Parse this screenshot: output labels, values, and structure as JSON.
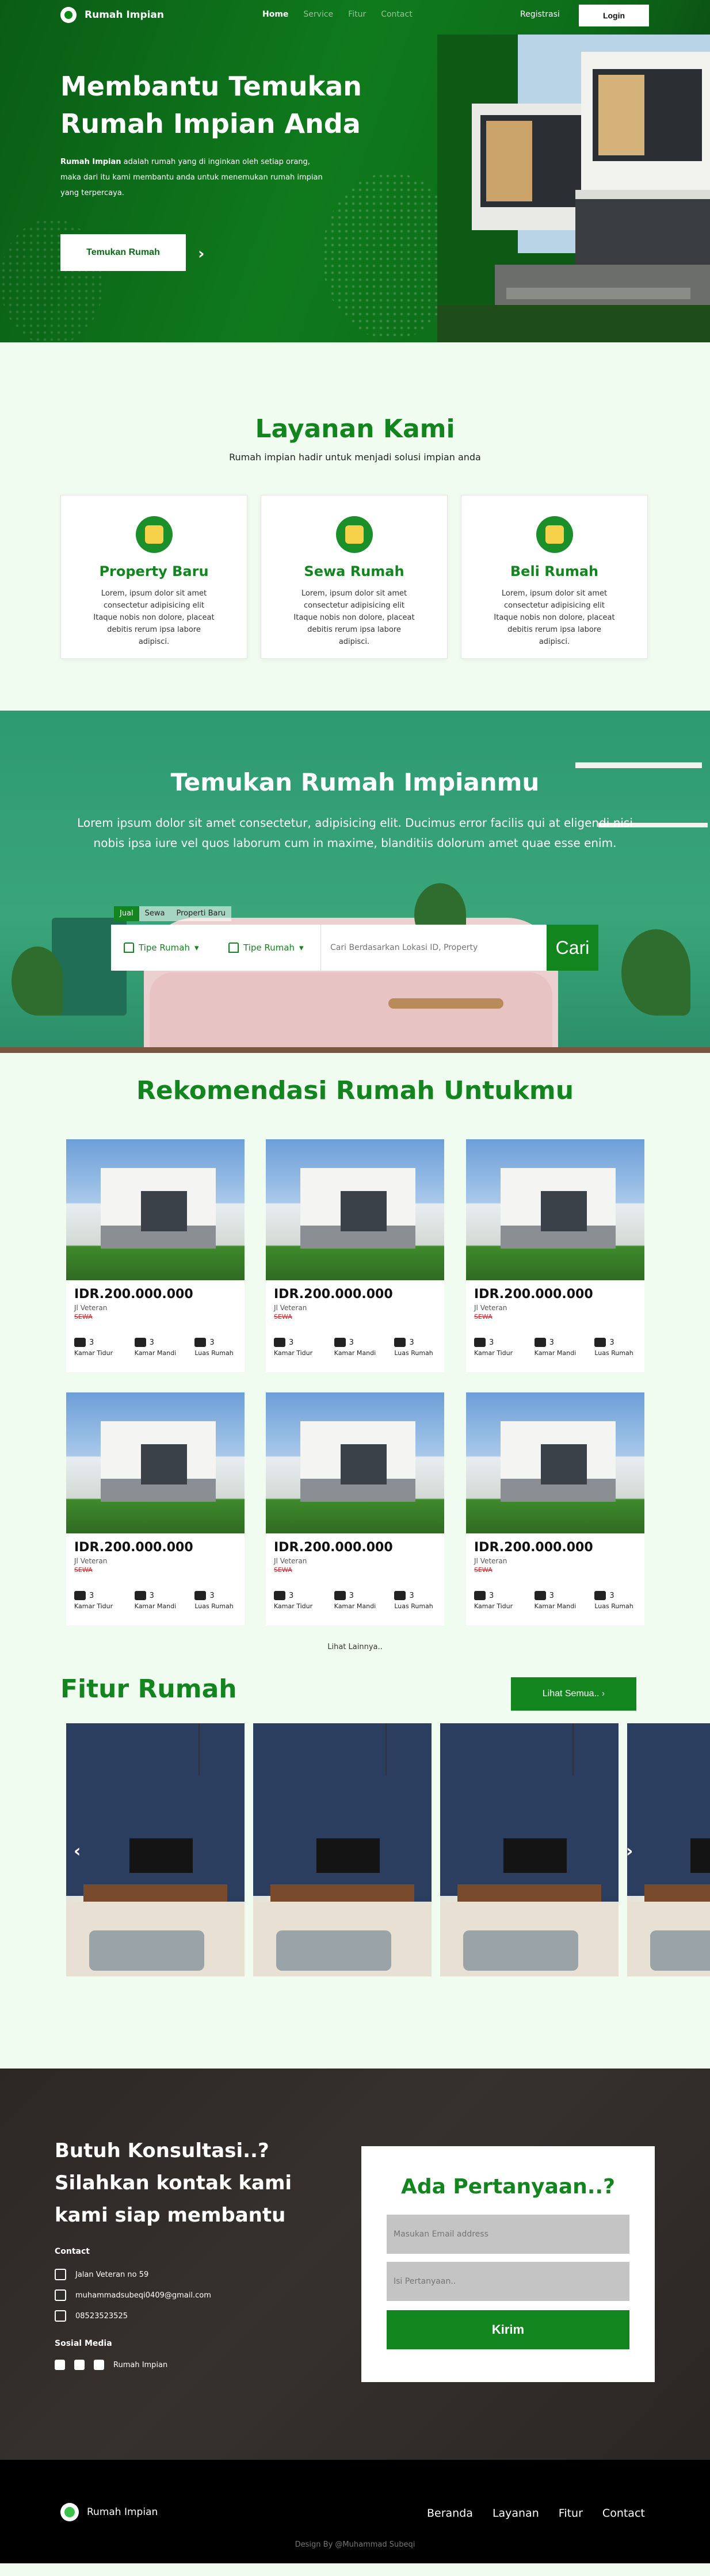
{
  "nav": {
    "brand": "Rumah Impian",
    "links": [
      "Home",
      "Service",
      "Fitur",
      "Contact"
    ],
    "register": "Registrasi",
    "login": "Login"
  },
  "hero": {
    "title": "Membantu Temukan Rumah Impian Anda",
    "desc_bold": "Rumah Impian",
    "desc": " adalah rumah yang di inginkan oleh setiap orang, maka dari itu kami membantu anda untuk menemukan rumah impian yang terpercaya.",
    "cta": "Temukan Rumah",
    "arrow": "›"
  },
  "layanan": {
    "title": "Layanan Kami",
    "subtitle": "Rumah impian hadir untuk menjadi solusi impian anda",
    "cards": [
      {
        "title": "Property Baru",
        "text": "Lorem, ipsum dolor sit amet consectetur adipisicing elit Itaque nobis non dolore, placeat debitis rerum ipsa labore adipisci."
      },
      {
        "title": "Sewa Rumah",
        "text": "Lorem, ipsum dolor sit amet consectetur adipisicing elit Itaque nobis non dolore, placeat debitis rerum ipsa labore adipisci."
      },
      {
        "title": "Beli Rumah",
        "text": "Lorem, ipsum dolor sit amet consectetur adipisicing elit Itaque nobis non dolore, placeat debitis rerum ipsa labore adipisci."
      }
    ]
  },
  "search": {
    "title": "Temukan Rumah Impianmu",
    "desc": "Lorem ipsum dolor sit amet consectetur, adipisicing elit. Ducimus error facilis qui at eligendi nisi nobis ipsa iure vel quos laborum cum in maxime, blanditiis dolorum amet quae esse enim.",
    "tabs": [
      "Jual",
      "Sewa",
      "Properti Baru"
    ],
    "select1": "Tipe Rumah",
    "select2": "Tipe Rumah",
    "placeholder": "Cari Berdasarkan Lokasi ID, Property",
    "button": "Cari"
  },
  "rekomendasi": {
    "title": "Rekomendasi Rumah Untukmu",
    "cards": [
      {
        "price": "IDR.200.000.000",
        "address": "Jl Veteran",
        "tag": "SEWA",
        "beds": "3",
        "baths": "3",
        "area": "3"
      },
      {
        "price": "IDR.200.000.000",
        "address": "Jl Veteran",
        "tag": "SEWA",
        "beds": "3",
        "baths": "3",
        "area": "3"
      },
      {
        "price": "IDR.200.000.000",
        "address": "Jl Veteran",
        "tag": "SEWA",
        "beds": "3",
        "baths": "3",
        "area": "3"
      },
      {
        "price": "IDR.200.000.000",
        "address": "Jl Veteran",
        "tag": "SEWA",
        "beds": "3",
        "baths": "3",
        "area": "3"
      },
      {
        "price": "IDR.200.000.000",
        "address": "Jl Veteran",
        "tag": "SEWA",
        "beds": "3",
        "baths": "3",
        "area": "3"
      },
      {
        "price": "IDR.200.000.000",
        "address": "Jl Veteran",
        "tag": "SEWA",
        "beds": "3",
        "baths": "3",
        "area": "3"
      }
    ],
    "labels": {
      "beds": "Kamar Tidur",
      "baths": "Kamar Mandi",
      "area": "Luas Rumah"
    },
    "more": "Lihat Lainnya.."
  },
  "fitur": {
    "title": "Fitur Rumah",
    "button": "Lihat Semua..",
    "prev": "‹",
    "next": "›"
  },
  "kontak": {
    "title": "Butuh Konsultasi..? Silahkan kontak kami kami siap membantu",
    "contact_label": "Contact",
    "address": "Jalan Veteran no 59",
    "email": "muhammadsubeqi0409@gmail.com",
    "phone": "08523523525",
    "social_label": "Sosial Media",
    "social_name": "Rumah Impian",
    "form_title": "Ada Pertanyaan..?",
    "email_placeholder": "Masukan Email address",
    "question_placeholder": "Isi Pertanyaan..",
    "submit": "Kirim"
  },
  "footer": {
    "brand": "Rumah Impian",
    "links": [
      "Beranda",
      "Layanan",
      "Fitur",
      "Contact"
    ],
    "credit": "Design By @Muhammad Subeqi"
  }
}
